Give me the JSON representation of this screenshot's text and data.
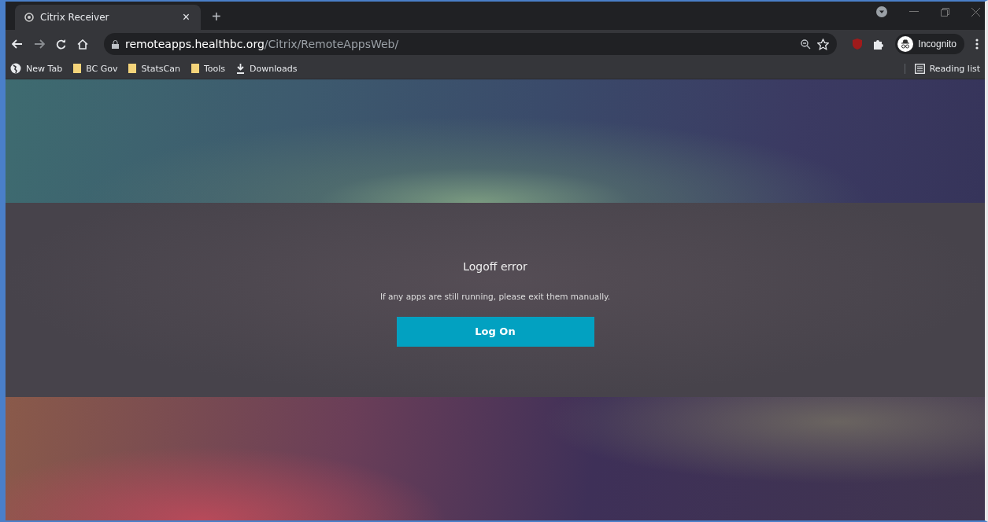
{
  "tab": {
    "title": "Citrix Receiver",
    "close": "×",
    "new_tab": "+"
  },
  "address": {
    "host": "remoteapps.healthbc.org",
    "path": "/Citrix/RemoteAppsWeb/"
  },
  "profile": {
    "label": "Incognito"
  },
  "bookmarks": [
    {
      "kind": "globe",
      "label": "New Tab"
    },
    {
      "kind": "folder",
      "label": "BC Gov"
    },
    {
      "kind": "folder",
      "label": "StatsCan"
    },
    {
      "kind": "folder",
      "label": "Tools"
    },
    {
      "kind": "download",
      "label": "Downloads"
    }
  ],
  "reading_list": {
    "label": "Reading list"
  },
  "dialog": {
    "title": "Logoff error",
    "message": "If any apps are still running, please exit them manually.",
    "button": "Log On"
  }
}
